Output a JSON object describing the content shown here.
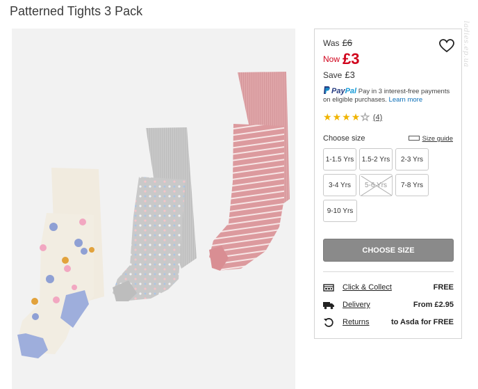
{
  "page": {
    "title": "Patterned Tights 3 Pack"
  },
  "watermark": "ladies.ep.ua",
  "price": {
    "was_label": "Was",
    "was_value": "£6",
    "now_label": "Now",
    "now_value": "£3",
    "save_label": "Save",
    "save_value": "£3",
    "accent_color": "#d0021b"
  },
  "paypal": {
    "brand_pay": "Pay",
    "brand_pal": "Pal",
    "text": "Pay in 3 interest-free payments on eligible purchases.",
    "learn_more": "Learn more"
  },
  "rating": {
    "stars": 4,
    "max": 5,
    "count": "(4)"
  },
  "sizes": {
    "label": "Choose size",
    "guide": "Size guide",
    "options": [
      {
        "label": "1-1.5 Yrs",
        "available": true
      },
      {
        "label": "1.5-2 Yrs",
        "available": true
      },
      {
        "label": "2-3 Yrs",
        "available": true
      },
      {
        "label": "3-4 Yrs",
        "available": true
      },
      {
        "label": "5-6 Yrs",
        "available": false
      },
      {
        "label": "7-8 Yrs",
        "available": true
      },
      {
        "label": "9-10 Yrs",
        "available": true
      }
    ]
  },
  "cta": {
    "label": "CHOOSE SIZE"
  },
  "delivery": {
    "rows": [
      {
        "icon": "store-icon",
        "link": "Click & Collect",
        "value": "FREE"
      },
      {
        "icon": "truck-icon",
        "link": "Delivery",
        "value": "From £2.95"
      },
      {
        "icon": "returns-icon",
        "link": "Returns",
        "value": "to Asda for FREE"
      }
    ]
  }
}
